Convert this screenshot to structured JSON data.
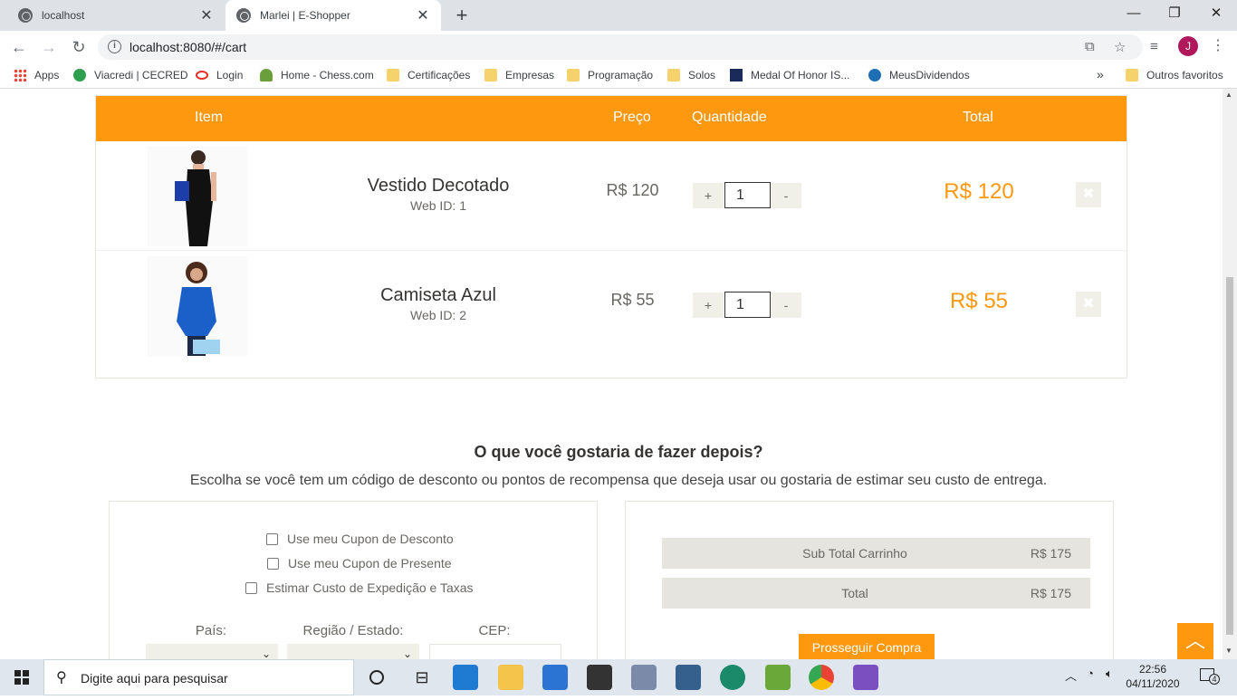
{
  "browser": {
    "tabs": [
      {
        "title": "localhost"
      },
      {
        "title": "Marlei | E-Shopper"
      }
    ],
    "url": "localhost:8080/#/cart",
    "profile_initial": "J",
    "bookmarks": [
      "Apps",
      "Viacredi | CECRED",
      "Login",
      "Home - Chess.com",
      "Certificações",
      "Empresas",
      "Programação",
      "Solos",
      "Medal Of Honor IS...",
      "MeusDividendos"
    ],
    "more_bookmarks": "»",
    "other_bookmarks": "Outros favoritos"
  },
  "cart": {
    "headers": {
      "item": "Item",
      "price": "Preço",
      "quantity": "Quantidade",
      "total": "Total"
    },
    "items": [
      {
        "name": "Vestido Decotado",
        "web_id": "Web ID: 1",
        "price": "R$ 120",
        "qty": "1",
        "total": "R$ 120",
        "plus": "+",
        "minus": "-"
      },
      {
        "name": "Camiseta Azul",
        "web_id": "Web ID: 2",
        "price": "R$ 55",
        "qty": "1",
        "total": "R$ 55",
        "plus": "+",
        "minus": "-"
      }
    ],
    "delete_glyph": "✖"
  },
  "do_action": {
    "title": "O que você gostaria de fazer depois?",
    "subtitle": "Escolha se você tem um código de desconto ou pontos de recompensa que deseja usar ou gostaria de estimar seu custo de entrega.",
    "options": [
      "Use meu Cupon de Desconto",
      "Use meu Cupon de Presente",
      "Estimar Custo de Expedição e Taxas"
    ],
    "labels": {
      "country": "País:",
      "region": "Região / Estado:",
      "zip": "CEP:"
    }
  },
  "summary": {
    "subtotal_label": "Sub Total Carrinho",
    "subtotal_value": "R$ 175",
    "total_label": "Total",
    "total_value": "R$ 175",
    "checkout": "Prosseguir Compra"
  },
  "taskbar": {
    "search_placeholder": "Digite aqui para pesquisar",
    "time": "22:56",
    "date": "04/11/2020",
    "notifications": "4"
  }
}
